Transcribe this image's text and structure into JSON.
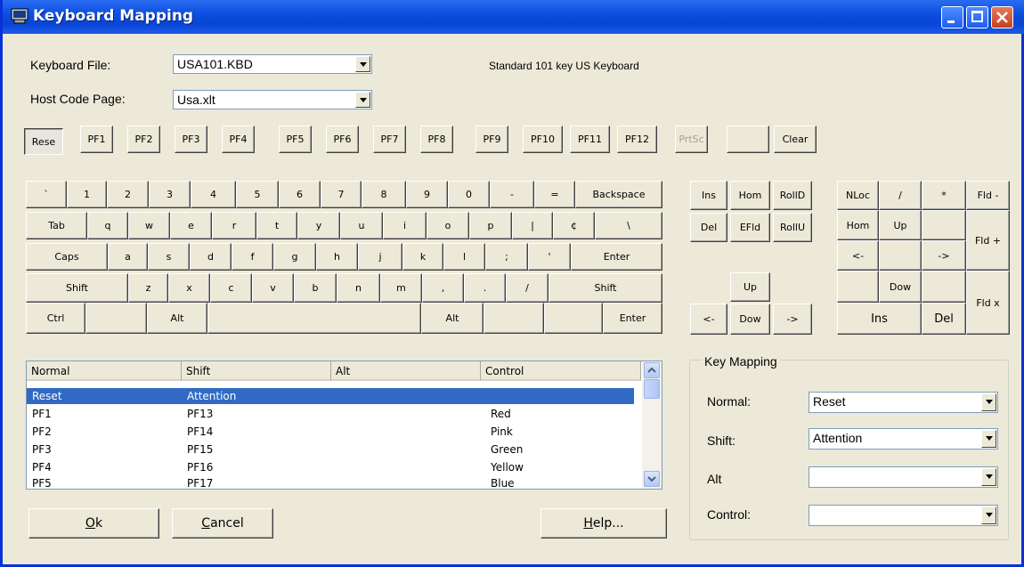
{
  "window": {
    "title": "Keyboard Mapping"
  },
  "form": {
    "keyboard_file_label": "Keyboard File:",
    "keyboard_file_value": "USA101.KBD",
    "keyboard_desc": "Standard 101 key US Keyboard",
    "host_code_page_label": "Host Code Page:",
    "host_code_page_value": "Usa.xlt"
  },
  "keys": {
    "reset": "Rese",
    "pf1": "PF1",
    "pf2": "PF2",
    "pf3": "PF3",
    "pf4": "PF4",
    "pf5": "PF5",
    "pf6": "PF6",
    "pf7": "PF7",
    "pf8": "PF8",
    "pf9": "PF9",
    "pf10": "PF10",
    "pf11": "PF11",
    "pf12": "PF12",
    "prtsc": "PrtSc",
    "blank": "",
    "clear": "Clear",
    "backtick": "`",
    "n1": "1",
    "n2": "2",
    "n3": "3",
    "n4": "4",
    "n5": "5",
    "n6": "6",
    "n7": "7",
    "n8": "8",
    "n9": "9",
    "n0": "0",
    "minus": "-",
    "equals": "=",
    "backspace": "Backspace",
    "tab": "Tab",
    "q": "q",
    "w": "w",
    "e": "e",
    "r": "r",
    "t": "t",
    "y": "y",
    "u": "u",
    "i": "i",
    "o": "o",
    "p": "p",
    "pipe": "|",
    "cent": "¢",
    "backslash": "\\",
    "caps": "Caps",
    "a": "a",
    "s": "s",
    "d": "d",
    "f": "f",
    "g": "g",
    "h": "h",
    "j": "j",
    "k": "k",
    "l": "l",
    "semicolon": ";",
    "quote": "'",
    "enter": "Enter",
    "shift": "Shift",
    "z": "z",
    "x": "x",
    "c": "c",
    "v": "v",
    "b": "b",
    "n": "n",
    "m": "m",
    "comma": ",",
    "period": ".",
    "slash": "/",
    "ctrl": "Ctrl",
    "alt": "Alt",
    "ins": "Ins",
    "hom": "Hom",
    "rolld": "RollD",
    "del": "Del",
    "efld": "EFld",
    "rollu": "RollU",
    "up": "Up",
    "left": "<-",
    "dow": "Dow",
    "right": "->",
    "nloc": "NLoc",
    "np_slash": "/",
    "np_star": "*",
    "fld_minus": "Fld -",
    "fld_plus": "Fld +",
    "fld_x": "Fld x"
  },
  "list": {
    "columns": [
      "Normal",
      "Shift",
      "Alt",
      "Control"
    ],
    "rows": [
      [
        "Reset",
        "Attention",
        "",
        ""
      ],
      [
        "PF1",
        "PF13",
        "",
        "Red"
      ],
      [
        "PF2",
        "PF14",
        "",
        "Pink"
      ],
      [
        "PF3",
        "PF15",
        "",
        "Green"
      ],
      [
        "PF4",
        "PF16",
        "",
        "Yellow"
      ],
      [
        "PF5",
        "PF17",
        "",
        "Blue"
      ]
    ]
  },
  "mapping": {
    "group_label": "Key Mapping",
    "normal_label": "Normal:",
    "normal_value": "Reset",
    "shift_label": "Shift:",
    "shift_value": "Attention",
    "alt_label": "Alt",
    "alt_value": "",
    "control_label": "Control:",
    "control_value": ""
  },
  "buttons": {
    "ok_u": "O",
    "ok_rest": "k",
    "cancel_u": "C",
    "cancel_rest": "ancel",
    "help_u": "H",
    "help_rest": "elp..."
  },
  "colors": {
    "titlebar": "#0d4fe0",
    "dialog": "#ece9d8",
    "selection": "#316ac5"
  }
}
